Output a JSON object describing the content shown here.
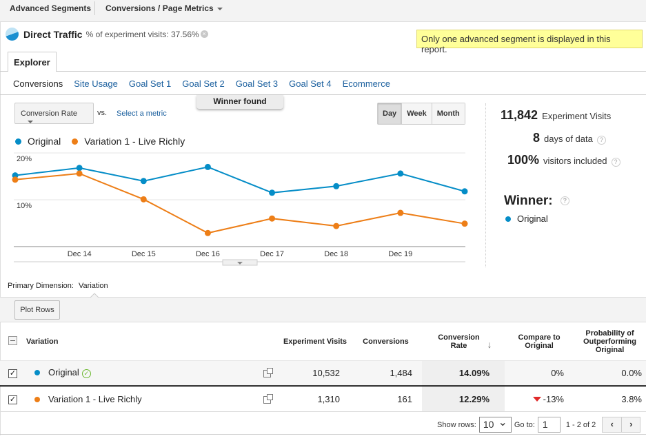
{
  "topbar": {
    "advanced_segments": "Advanced Segments",
    "metrics_menu": "Conversions / Page Metrics"
  },
  "segment": {
    "title": "Direct Traffic",
    "subtitle": "% of experiment visits: 37.56%",
    "remove_icon": "x-circle-icon"
  },
  "notice": "Only one advanced segment is displayed in this report.",
  "tabs": {
    "explorer": "Explorer"
  },
  "subnav": [
    "Conversions",
    "Site Usage",
    "Goal Set 1",
    "Goal Set 2",
    "Goal Set 3",
    "Goal Set 4",
    "Ecommerce"
  ],
  "winner_found": "Winner found",
  "chart_controls": {
    "metric": "Conversion Rate",
    "vs": "vs.",
    "select_metric": "Select a metric",
    "periods": [
      "Day",
      "Week",
      "Month"
    ],
    "active_period": "Day"
  },
  "colors": {
    "original": "#058dc7",
    "variation": "#ed7e17",
    "link": "#1a5f9e",
    "negative": "#e02a2a",
    "winner_check": "#6bb82f"
  },
  "chart_data": {
    "type": "line",
    "title": "",
    "xlabel": "",
    "ylabel": "Conversion Rate",
    "x": [
      "Dec 13",
      "Dec 14",
      "Dec 15",
      "Dec 16",
      "Dec 17",
      "Dec 18",
      "Dec 19",
      "Dec 20"
    ],
    "x_tick_labels": [
      "Dec 14",
      "Dec 15",
      "Dec 16",
      "Dec 17",
      "Dec 18",
      "Dec 19"
    ],
    "y_tick_labels": [
      "20%",
      "10%"
    ],
    "y_ticks": [
      20,
      10
    ],
    "ylim": [
      0,
      20
    ],
    "grid": true,
    "legend": "top-left",
    "series": [
      {
        "name": "Original",
        "color": "#058dc7",
        "values": [
          15.2,
          16.8,
          14.0,
          17.0,
          11.5,
          12.9,
          15.6,
          11.8
        ]
      },
      {
        "name": "Variation 1 - Live Richly",
        "color": "#ed7e17",
        "values": [
          14.3,
          15.6,
          10.1,
          2.9,
          6.0,
          4.4,
          7.2,
          4.9
        ]
      }
    ]
  },
  "stats": {
    "visits_value": "11,842",
    "visits_label": "Experiment Visits",
    "days_value": "8",
    "days_label": "days of data",
    "visitors_value": "100%",
    "visitors_label": "visitors included",
    "winner_title": "Winner:",
    "winner": "Original",
    "help": "?"
  },
  "primary_dimension": {
    "label": "Primary Dimension:",
    "value": "Variation"
  },
  "plot_rows": "Plot Rows",
  "table": {
    "headers": {
      "variation": "Variation",
      "visits": "Experiment Visits",
      "conversions": "Conversions",
      "rate": "Conversion Rate",
      "compare": "Compare to Original",
      "probability": "Probability of Outperforming Original"
    },
    "rows": [
      {
        "name": "Original",
        "visits": "10,532",
        "conversions": "1,484",
        "rate": "14.09%",
        "compare": "0%",
        "probability": "0.0%",
        "checked": true
      },
      {
        "name": "Variation 1 - Live Richly",
        "visits": "1,310",
        "conversions": "161",
        "rate": "12.29%",
        "compare": "-13%",
        "probability": "3.8%",
        "checked": true
      }
    ]
  },
  "footer": {
    "show_rows_label": "Show rows:",
    "show_rows_value": "10",
    "goto_label": "Go to:",
    "goto_value": "1",
    "range": "1 - 2 of 2",
    "prev": "‹",
    "next": "›"
  }
}
